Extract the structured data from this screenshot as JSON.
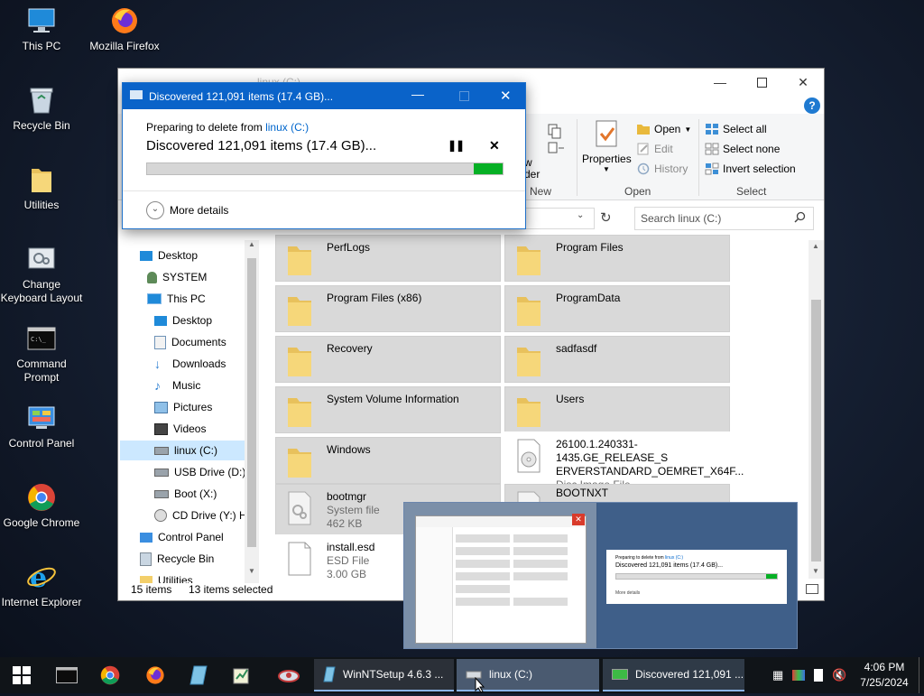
{
  "desktop": {
    "icons": [
      {
        "label": "This PC",
        "icon": "this-pc-icon"
      },
      {
        "label": "Mozilla Firefox",
        "icon": "firefox-icon"
      },
      {
        "label": "Recycle Bin",
        "icon": "recycle-bin-icon"
      },
      {
        "label": "Utilities",
        "icon": "folder-icon"
      },
      {
        "label": "Change Keyboard Layout",
        "icon": "keyboard-layout-icon"
      },
      {
        "label": "Command Prompt",
        "icon": "command-prompt-icon"
      },
      {
        "label": "Control Panel",
        "icon": "control-panel-icon"
      },
      {
        "label": "Google Chrome",
        "icon": "chrome-icon"
      },
      {
        "label": "Internet Explorer",
        "icon": "internet-explorer-icon"
      }
    ]
  },
  "explorer": {
    "title": "linux (C:)",
    "ribbon": {
      "new_group": {
        "label": "New",
        "partial_item": "w der"
      },
      "open_group": {
        "label": "Open",
        "properties": "Properties",
        "open": "Open",
        "edit": "Edit",
        "history": "History"
      },
      "select_group": {
        "label": "Select",
        "select_all": "Select all",
        "select_none": "Select none",
        "invert_selection": "Invert selection"
      }
    },
    "search_placeholder": "Search linux (C:)",
    "nav": [
      {
        "label": "Desktop",
        "level": 0
      },
      {
        "label": "SYSTEM",
        "level": 1
      },
      {
        "label": "This PC",
        "level": 1
      },
      {
        "label": "Desktop",
        "level": 2
      },
      {
        "label": "Documents",
        "level": 2
      },
      {
        "label": "Downloads",
        "level": 2
      },
      {
        "label": "Music",
        "level": 2
      },
      {
        "label": "Pictures",
        "level": 2
      },
      {
        "label": "Videos",
        "level": 2
      },
      {
        "label": "linux (C:)",
        "level": 2,
        "selected": true
      },
      {
        "label": "USB Drive (D:)",
        "level": 2
      },
      {
        "label": "Boot (X:)",
        "level": 2
      },
      {
        "label": "CD Drive (Y:) H",
        "level": 2
      },
      {
        "label": "Control Panel",
        "level": 1
      },
      {
        "label": "Recycle Bin",
        "level": 1
      },
      {
        "label": "Utilities",
        "level": 1
      }
    ],
    "files": [
      {
        "name": "PerfLogs",
        "sub": "",
        "sub2": "",
        "type": "folder",
        "selected": true
      },
      {
        "name": "Program Files",
        "sub": "",
        "sub2": "",
        "type": "folder",
        "selected": true
      },
      {
        "name": "Program Files (x86)",
        "sub": "",
        "sub2": "",
        "type": "folder",
        "selected": true
      },
      {
        "name": "ProgramData",
        "sub": "",
        "sub2": "",
        "type": "folder",
        "selected": true
      },
      {
        "name": "Recovery",
        "sub": "",
        "sub2": "",
        "type": "folder",
        "selected": true
      },
      {
        "name": "sadfasdf",
        "sub": "",
        "sub2": "",
        "type": "folder",
        "selected": true
      },
      {
        "name": "System Volume Information",
        "sub": "",
        "sub2": "",
        "type": "folder",
        "selected": true
      },
      {
        "name": "Users",
        "sub": "",
        "sub2": "",
        "type": "folder",
        "selected": true
      },
      {
        "name": "Windows",
        "sub": "",
        "sub2": "",
        "type": "folder",
        "selected": true
      },
      {
        "name": "26100.1.240331-1435.GE_RELEASE_S ERVERSTANDARD_OEMRET_X64F...",
        "sub": "Disc Image File",
        "sub2": "",
        "type": "disc",
        "selected": false
      },
      {
        "name": "bootmgr",
        "sub": "System file",
        "sub2": "462 KB",
        "type": "sysfile",
        "selected": true
      },
      {
        "name": "BOOTNXT",
        "sub": "",
        "sub2": "",
        "type": "sysfile",
        "selected": true
      },
      {
        "name": "install.esd",
        "sub": "ESD File",
        "sub2": "3.00 GB",
        "type": "file",
        "selected": false
      }
    ],
    "status": {
      "count": "15 items",
      "selected": "13 items selected"
    }
  },
  "dialog": {
    "title": "Discovered 121,091 items (17.4 GB)...",
    "preparing_prefix": "Preparing to delete from ",
    "preparing_link": "linux (C:)",
    "heading": "Discovered 121,091 items (17.4 GB)...",
    "progress_fraction": 0.92,
    "more_details": "More details",
    "pause_icon": "pause-icon",
    "cancel_icon": "close-icon"
  },
  "thumbnail": {
    "preparing_prefix": "Preparing to delete from ",
    "preparing_link": "linux (C:)",
    "heading": "Discovered 121,091 items (17.4 GB)...",
    "more_details": "More details"
  },
  "taskbar": {
    "pinned": [
      "start-icon",
      "command-prompt-icon",
      "chrome-icon",
      "firefox-icon",
      "notepad-icon",
      "winntsetup-icon",
      "network-icon"
    ],
    "windows": [
      {
        "label": "WinNTSetup 4.6.3   ..."
      },
      {
        "label": "linux (C:)"
      },
      {
        "label": "Discovered 121,091 ..."
      }
    ],
    "clock_time": "4:06 PM",
    "clock_date": "7/25/2024"
  },
  "colors": {
    "accent": "#0a63c9",
    "progress_green": "#06b025",
    "selection": "#cce8ff"
  }
}
